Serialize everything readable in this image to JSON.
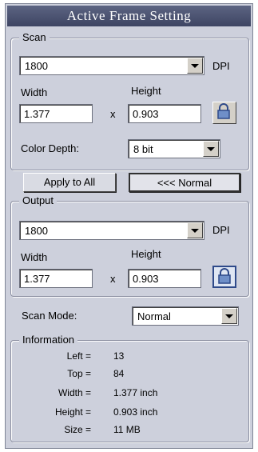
{
  "title": "Active Frame Setting",
  "scan": {
    "legend": "Scan",
    "dpi_value": "1800",
    "dpi_label": "DPI",
    "width_label": "Width",
    "height_label": "Height",
    "width_value": "1.377",
    "height_value": "0.903",
    "x_label": "x",
    "color_depth_label": "Color Depth:",
    "color_depth_value": "8 bit"
  },
  "buttons": {
    "apply_to_all": "Apply to All",
    "normal": "<<< Normal"
  },
  "output": {
    "legend": "Output",
    "dpi_value": "1800",
    "dpi_label": "DPI",
    "width_label": "Width",
    "height_label": "Height",
    "width_value": "1.377",
    "height_value": "0.903",
    "x_label": "x"
  },
  "scan_mode": {
    "label": "Scan Mode:",
    "value": "Normal"
  },
  "information": {
    "legend": "Information",
    "rows": [
      {
        "key": "Left =",
        "value": "13"
      },
      {
        "key": "Top =",
        "value": "84"
      },
      {
        "key": "Width =",
        "value": "1.377 inch"
      },
      {
        "key": "Height =",
        "value": "0.903 inch"
      },
      {
        "key": "Size =",
        "value": "11 MB"
      }
    ]
  },
  "icons": {
    "scan_lock": "lock-icon",
    "output_lock": "lock-icon"
  }
}
